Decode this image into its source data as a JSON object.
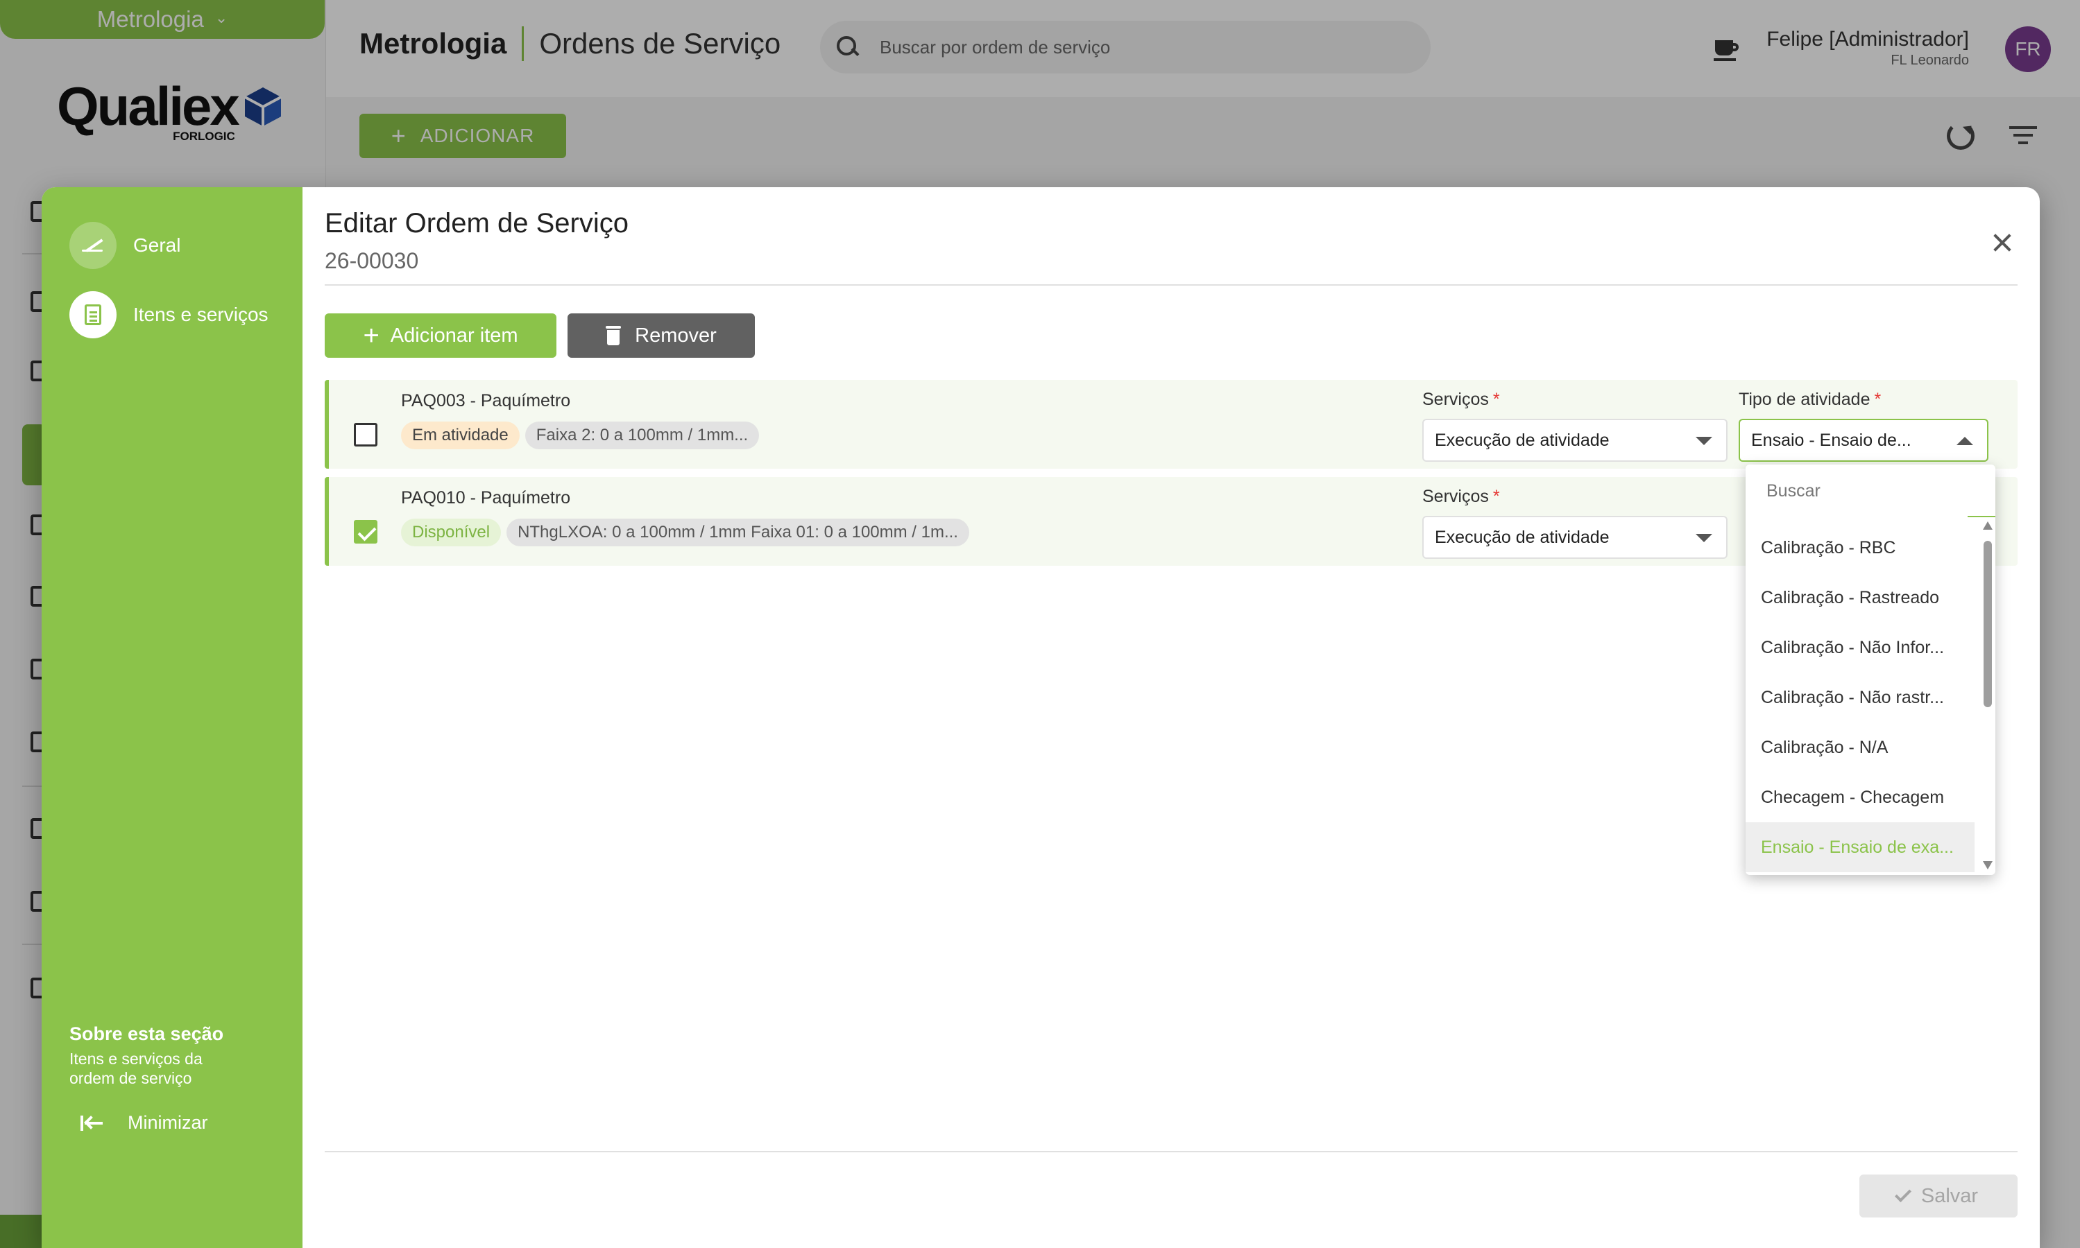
{
  "app": {
    "module": "Metrologia",
    "logo_text": "Qualiex",
    "logo_sub": "FORLOGIC",
    "breadcrumb_main": "Metrologia",
    "breadcrumb_sub": "Ordens de Serviço",
    "search_placeholder": "Buscar por ordem de serviço",
    "user_name": "Felipe [Administrador]",
    "user_org": "FL Leonardo",
    "avatar_initials": "FR",
    "add_button": "ADICIONAR",
    "accent_color": "#8bc34a"
  },
  "dialog": {
    "title": "Editar Ordem de Serviço",
    "code": "26-00030",
    "nav": [
      {
        "label": "Geral",
        "icon": "pen-icon",
        "active": false
      },
      {
        "label": "Itens e serviços",
        "icon": "clipboard-icon",
        "active": true
      }
    ],
    "about_title": "Sobre esta seção",
    "about_text": "Itens e serviços da ordem de serviço",
    "minimize_label": "Minimizar",
    "add_item_label": "Adicionar item",
    "remove_label": "Remover",
    "save_label": "Salvar",
    "items": [
      {
        "name": "PAQ003 - Paquímetro",
        "checked": false,
        "status": "Em atividade",
        "range": "Faixa 2: 0 a 100mm / 1mm...",
        "services_label": "Serviços",
        "services_value": "Execução de atividade",
        "activity_label": "Tipo de atividade",
        "activity_value": "Ensaio - Ensaio de..."
      },
      {
        "name": "PAQ010 - Paquímetro",
        "checked": true,
        "status": "Disponível",
        "range": "NThgLXOA: 0 a 100mm / 1mm Faixa 01: 0 a 100mm / 1m...",
        "services_label": "Serviços",
        "services_value": "Execução de atividade"
      }
    ],
    "dropdown": {
      "search_placeholder": "Buscar",
      "options": [
        "Calibração - RBC",
        "Calibração - Rastreado",
        "Calibração - Não Infor...",
        "Calibração - Não rastr...",
        "Calibração - N/A",
        "Checagem - Checagem",
        "Ensaio - Ensaio de exa..."
      ],
      "selected": "Ensaio - Ensaio de exa..."
    }
  }
}
